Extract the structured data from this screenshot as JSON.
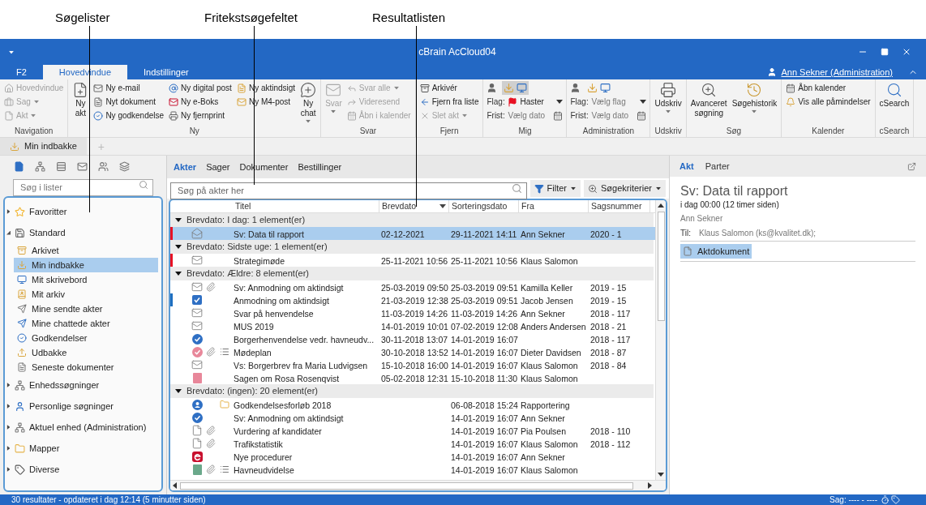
{
  "annotations": [
    "Søgelister",
    "Fritekstsøgefeltet",
    "Resultatlisten"
  ],
  "window": {
    "title": "cBrain AcCloud04"
  },
  "ribbon_tabs": [
    {
      "label": "F2",
      "selected": false
    },
    {
      "label": "Hovedvindue",
      "selected": true
    },
    {
      "label": "Indstillinger",
      "selected": false
    }
  ],
  "user": "Ann Sekner (Administration)",
  "ribbon_groups": [
    {
      "label": "Navigation",
      "items": [
        {
          "kind": "small",
          "label": "Hovedvindue",
          "disabled": true,
          "dropdown": false
        },
        {
          "kind": "small",
          "label": "Sag",
          "disabled": true,
          "dropdown": true
        },
        {
          "kind": "small",
          "label": "Akt",
          "disabled": true,
          "dropdown": true
        }
      ]
    },
    {
      "label": "Ny",
      "items": [
        {
          "kind": "large",
          "label": "Ny\nakt",
          "disabled": false,
          "dropdown": false
        },
        {
          "kind": "small",
          "label": "Ny e-mail",
          "disabled": false,
          "dropdown": false
        },
        {
          "kind": "small",
          "label": "Nyt dokument",
          "disabled": false,
          "dropdown": false
        },
        {
          "kind": "small",
          "label": "Ny godkendelse",
          "disabled": false,
          "dropdown": false
        },
        {
          "kind": "small",
          "label": "Ny digital post",
          "disabled": false,
          "dropdown": false
        },
        {
          "kind": "small",
          "label": "Ny e-Boks",
          "disabled": false,
          "dropdown": false
        },
        {
          "kind": "small",
          "label": "Ny fjernprint",
          "disabled": false,
          "dropdown": false
        },
        {
          "kind": "small",
          "label": "Ny aktindsigt",
          "disabled": false,
          "dropdown": false
        },
        {
          "kind": "small",
          "label": "Ny M4-post",
          "disabled": false,
          "dropdown": false
        },
        {
          "kind": "large",
          "label": "Ny\nchat",
          "disabled": false,
          "dropdown": true
        }
      ]
    },
    {
      "label": "Svar",
      "items": [
        {
          "kind": "large",
          "label": "Svar",
          "disabled": true,
          "dropdown": true
        },
        {
          "kind": "small",
          "label": "Svar alle",
          "disabled": true,
          "dropdown": true
        },
        {
          "kind": "small",
          "label": "Videresend",
          "disabled": true,
          "dropdown": false
        },
        {
          "kind": "small",
          "label": "Åbn i kalender",
          "disabled": true,
          "dropdown": false
        }
      ]
    },
    {
      "label": "Fjern",
      "items": [
        {
          "kind": "small",
          "label": "Arkivér",
          "disabled": false,
          "dropdown": false
        },
        {
          "kind": "small",
          "label": "Fjern fra liste",
          "disabled": false,
          "dropdown": false
        },
        {
          "kind": "small",
          "label": "Slet akt",
          "disabled": true,
          "dropdown": true
        }
      ]
    },
    {
      "label": "Mig",
      "items": [
        {
          "kind": "iconrow",
          "active": true
        },
        {
          "kind": "field",
          "label": "Flag:",
          "value": "Haster",
          "flagged": true,
          "dropdown": true
        },
        {
          "kind": "field",
          "label": "Frist:",
          "placeholder": "Vælg dato",
          "flagged": false,
          "dropdown": false
        }
      ]
    },
    {
      "label": "Administration",
      "items": [
        {
          "kind": "iconrow",
          "active": false
        },
        {
          "kind": "field",
          "label": "Flag:",
          "placeholder": "Vælg flag",
          "flagged": false,
          "dropdown": true
        },
        {
          "kind": "field",
          "label": "Frist:",
          "placeholder": "Vælg dato",
          "flagged": false,
          "dropdown": false
        }
      ]
    },
    {
      "label": "Udskriv",
      "items": [
        {
          "kind": "large",
          "label": "Udskriv",
          "disabled": false,
          "dropdown": true
        }
      ]
    },
    {
      "label": "Søg",
      "items": [
        {
          "kind": "large",
          "label": "Avanceret\nsøgning",
          "disabled": false,
          "dropdown": false
        },
        {
          "kind": "large",
          "label": "Søgehistorik",
          "disabled": false,
          "dropdown": true
        }
      ]
    },
    {
      "label": "Kalender",
      "items": [
        {
          "kind": "small",
          "label": "Åbn kalender",
          "disabled": false
        },
        {
          "kind": "small",
          "label": "Vis alle påmindelser",
          "disabled": false
        }
      ]
    },
    {
      "label": "cSearch",
      "items": [
        {
          "kind": "large",
          "label": "cSearch",
          "disabled": false,
          "dropdown": false
        }
      ]
    }
  ],
  "doc_tab": "Min indbakke",
  "add_tab": "+",
  "list_views": [
    {
      "selected": true
    },
    {
      "selected": false
    },
    {
      "selected": false
    },
    {
      "selected": false
    },
    {
      "selected": false
    },
    {
      "selected": false
    }
  ],
  "list_search": {
    "placeholder": "Søg i lister"
  },
  "tree": [
    {
      "label": "Favoritter",
      "expanded": false,
      "selected": false
    },
    {
      "label": "Standard",
      "expanded": true,
      "selected": false,
      "children": [
        {
          "label": "Arkivet",
          "selected": false
        },
        {
          "label": "Min indbakke",
          "selected": true
        },
        {
          "label": "Mit skrivebord",
          "selected": false
        },
        {
          "label": "Mit arkiv",
          "selected": false
        },
        {
          "label": "Mine sendte akter",
          "selected": false
        },
        {
          "label": "Mine chattede akter",
          "selected": false
        },
        {
          "label": "Godkendelser",
          "selected": false
        },
        {
          "label": "Udbakke",
          "selected": false
        },
        {
          "label": "Seneste dokumenter",
          "selected": false
        }
      ]
    },
    {
      "label": "Enhedssøgninger",
      "expanded": false,
      "selected": false
    },
    {
      "label": "Personlige søgninger",
      "expanded": false,
      "selected": false
    },
    {
      "label": "Aktuel enhed (Administration)",
      "expanded": false,
      "selected": false
    },
    {
      "label": "Mapper",
      "expanded": false,
      "selected": false
    },
    {
      "label": "Diverse",
      "expanded": false,
      "selected": false
    }
  ],
  "result_tabs": [
    {
      "label": "Akter",
      "selected": true
    },
    {
      "label": "Sager",
      "selected": false
    },
    {
      "label": "Dokumenter",
      "selected": false
    },
    {
      "label": "Bestillinger",
      "selected": false
    }
  ],
  "search": {
    "placeholder": "Søg på akter her"
  },
  "filter_button": "Filter",
  "criteria_button": "Søgekriterier",
  "table": {
    "columns": [
      {
        "label": "Titel",
        "sorted": false
      },
      {
        "label": "Brevdato",
        "sorted": true
      },
      {
        "label": "Sorteringsdato",
        "sorted": false
      },
      {
        "label": "Fra",
        "sorted": false
      },
      {
        "label": "Sagsnummer",
        "sorted": false
      }
    ],
    "groups": [
      {
        "label": "Brevdato: I dag: 1 element(er)",
        "expanded": true,
        "rows": [
          {
            "kind": "reply",
            "marker": {
              "color": "#e81123"
            },
            "attachment": false,
            "selected": true,
            "title": "Sv: Data til rapport",
            "brevdato": "02-12-2021",
            "sorteringsdato": "29-11-2021 14:11",
            "fra": "Ann Sekner",
            "sagsnummer": "2020 - 1"
          }
        ]
      },
      {
        "label": "Brevdato: Sidste uge: 1 element(er)",
        "expanded": true,
        "rows": [
          {
            "kind": "email",
            "marker": {
              "color": "#e81123"
            },
            "attachment": false,
            "selected": false,
            "title": "Strategimøde",
            "brevdato": "25-11-2021 10:56",
            "sorteringsdato": "25-11-2021 10:56",
            "fra": "Klaus Salomon"
          }
        ]
      },
      {
        "label": "Brevdato: Ældre: 8 element(er)",
        "expanded": true,
        "rows": [
          {
            "kind": "email",
            "attachment": true,
            "selected": false,
            "title": "Sv: Anmodning om aktindsigt",
            "brevdato": "25-03-2019 09:50",
            "sorteringsdato": "25-03-2019 09:51",
            "fra": "Kamilla Keller",
            "sagsnummer": "2019 - 15"
          },
          {
            "kind": "task",
            "marker": {
              "color": "#1e6fc0"
            },
            "attachment": false,
            "selected": false,
            "title": "Anmodning om aktindsigt",
            "brevdato": "21-03-2019 12:38",
            "sorteringsdato": "25-03-2019 09:51",
            "fra": "Jacob Jensen",
            "sagsnummer": "2019 - 15"
          },
          {
            "kind": "email",
            "attachment": false,
            "selected": false,
            "title": "Svar på henvendelse",
            "brevdato": "11-03-2019 14:26",
            "sorteringsdato": "11-03-2019 14:26",
            "fra": "Ann Sekner",
            "sagsnummer": "2018 - 117"
          },
          {
            "kind": "email",
            "attachment": false,
            "selected": false,
            "title": "MUS 2019",
            "brevdato": "14-01-2019 10:01",
            "sorteringsdato": "07-02-2019 12:08",
            "fra": "Anders Andersen",
            "sagsnummer": "2018 - 21"
          },
          {
            "kind": "approval",
            "attachment": false,
            "selected": false,
            "title": "Borgerhenvendelse vedr. havneudv...",
            "brevdato": "30-11-2018 13:07",
            "sorteringsdato": "14-01-2019 16:07",
            "sagsnummer": "2018 - 117"
          },
          {
            "kind": "approval_rejected",
            "attachment": true,
            "agenda": true,
            "selected": false,
            "title": "Mødeplan",
            "brevdato": "30-10-2018 13:52",
            "sorteringsdato": "14-01-2019 16:07",
            "fra": "Dieter Davidsen",
            "sagsnummer": "2018 - 87"
          },
          {
            "kind": "email",
            "attachment": false,
            "selected": false,
            "title": "Vs: Borgerbrev fra Maria Ludvigsen",
            "brevdato": "15-10-2018 16:00",
            "sorteringsdato": "14-01-2019 16:07",
            "fra": "Klaus Salomon",
            "sagsnummer": "2018 - 84"
          },
          {
            "kind": "case",
            "color": "#e8879a",
            "attachment": false,
            "selected": false,
            "title": "Sagen om Rosa Rosenqvist",
            "brevdato": "05-02-2018 12:31",
            "sorteringsdato": "15-10-2018 11:30",
            "fra": "Klaus Salomon"
          }
        ]
      },
      {
        "label": "Brevdato: (ingen): 20 element(er)",
        "expanded": true,
        "rows": [
          {
            "kind": "group",
            "attachment": false,
            "folder": true,
            "selected": false,
            "title": "Godkendelsesforløb 2018",
            "sorteringsdato": "06-08-2018 15:24",
            "fra": "Rapportering"
          },
          {
            "kind": "approval",
            "attachment": false,
            "selected": false,
            "title": "Sv: Anmodning om aktindsigt",
            "sorteringsdato": "14-01-2019 16:07",
            "fra": "Ann Sekner"
          },
          {
            "kind": "document",
            "attachment": true,
            "selected": false,
            "title": "Vurdering af kandidater",
            "sorteringsdato": "14-01-2019 16:07",
            "fra": "Pia Poulsen",
            "sagsnummer": "2018 - 110"
          },
          {
            "kind": "document",
            "attachment": true,
            "selected": false,
            "title": "Trafikstatistik",
            "sorteringsdato": "14-01-2019 16:07",
            "fra": "Klaus Salomon",
            "sagsnummer": "2018 - 112"
          },
          {
            "kind": "eboks",
            "attachment": false,
            "selected": false,
            "title": "Nye procedurer",
            "sorteringsdato": "14-01-2019 16:07",
            "fra": "Ann Sekner"
          },
          {
            "kind": "case",
            "color": "#6aa88a",
            "attachment": true,
            "agenda": true,
            "selected": false,
            "title": "Havneudvidelse",
            "sorteringsdato": "14-01-2019 16:07",
            "fra": "Klaus Salomon"
          }
        ]
      }
    ]
  },
  "detail_tabs": [
    {
      "label": "Akt",
      "selected": true
    },
    {
      "label": "Parter",
      "selected": false
    }
  ],
  "detail": {
    "title": "Sv: Data til rapport",
    "date": "i dag 00:00 (12 timer siden)",
    "sender": "Ann Sekner",
    "to_label": "Til:",
    "to": "Klaus Salomon (ks@kvalitet.dk);",
    "attachment": "Aktdokument"
  },
  "status_bar": {
    "left": "30 resultater - opdateret i dag 12:14 (5 minutter siden)",
    "right": "Sag: ---- - ----"
  }
}
